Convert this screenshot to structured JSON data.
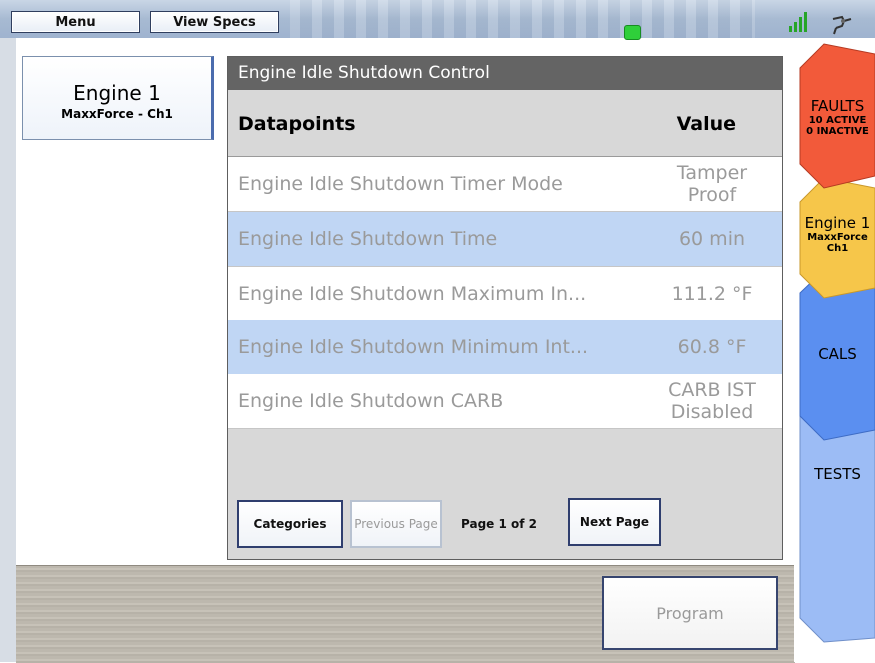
{
  "toolbar": {
    "menu_label": "Menu",
    "view_specs_label": "View Specs"
  },
  "engine_tab": {
    "title": "Engine 1",
    "subtitle": "MaxxForce - Ch1"
  },
  "dialog": {
    "title": "Engine Idle Shutdown Control",
    "headers": {
      "datapoints": "Datapoints",
      "value": "Value"
    },
    "rows": [
      {
        "name": "Engine Idle Shutdown Timer Mode",
        "value": "Tamper Proof"
      },
      {
        "name": "Engine Idle Shutdown Time",
        "value": "60 min"
      },
      {
        "name": "Engine Idle Shutdown Maximum In...",
        "value": "111.2 °F"
      },
      {
        "name": "Engine Idle Shutdown Minimum Int...",
        "value": "60.8 °F"
      },
      {
        "name": "Engine Idle Shutdown CARB",
        "value": "CARB IST Disabled"
      }
    ],
    "buttons": {
      "categories": "Categories",
      "previous_page": "Previous Page",
      "next_page": "Next Page"
    },
    "page_info": "Page 1 of 2"
  },
  "program_label": "Program",
  "side_tabs": {
    "faults": {
      "label": "FAULTS",
      "active": "10 ACTIVE",
      "inactive": "0 INACTIVE",
      "color": "#f25a3a"
    },
    "engine": {
      "label": "Engine 1",
      "sub1": "MaxxForce",
      "sub2": "Ch1",
      "color": "#f6c64a"
    },
    "cals": {
      "label": "CALS",
      "color": "#5b8ff0"
    },
    "tests": {
      "label": "TESTS",
      "color": "#9cbcf5"
    }
  },
  "colors": {
    "row_highlight": "#c0d6f4",
    "status_led": "#2fcf3a",
    "signal_green": "#27a527"
  }
}
